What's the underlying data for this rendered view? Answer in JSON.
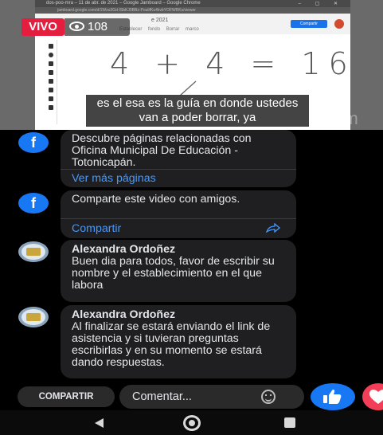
{
  "video": {
    "browser_tab_title": "dos-poo-mra – 11 de abr. de 2021 – Google Jamboard – Google Chrome",
    "browser_url": "jamboard.google.com/d/1Wzu3Gd-ISbKJ0BBz-PoulifKu4kvbYOFWRKs/viewer",
    "jamboard_title_suffix": "e 2021",
    "jamboard_toolbar": "Establecer fondo   Borrar marco",
    "share_button": "Compartir",
    "live_badge": "VIVO",
    "viewer_count": "108",
    "equation": "4 + 4 = 16",
    "subtitle": "es el esa es la guía en donde ustedes van a poder borrar, ya",
    "watermark": "zoom"
  },
  "feed": {
    "card_pages": {
      "text": "Descubre páginas relacionadas con Oficina Municipal De Educación - Totonicapán.",
      "link": "Ver más páginas"
    },
    "card_share": {
      "text": "Comparte este video con amigos.",
      "link": "Compartir"
    },
    "comments": [
      {
        "author": "Alexandra Ordoñez",
        "text": "Buen dia para todos, favor de escribir su nombre y el establecimiento en el que labora"
      },
      {
        "author": "Alexandra Ordoñez",
        "text": "Al finalizar se estará enviando el link de asistencia y si tuvieran preguntas escribirlas y en su momento se estará dando respuestas."
      }
    ]
  },
  "bottom_bar": {
    "share_label": "COMPARTIR",
    "comment_placeholder": "Comentar..."
  },
  "colors": {
    "live_red": "#e41e3f",
    "facebook_blue": "#1877f2",
    "link_blue": "#4599ff",
    "bubble_bg": "#1f1f21"
  },
  "icons": {
    "live_viewers": "eye-icon",
    "facebook": "facebook-icon",
    "share": "share-arrow-icon",
    "emoji": "emoji-icon",
    "like": "like-icon",
    "love": "love-icon",
    "nav_back": "back-icon",
    "nav_home": "home-icon",
    "nav_recent": "recent-apps-icon"
  }
}
